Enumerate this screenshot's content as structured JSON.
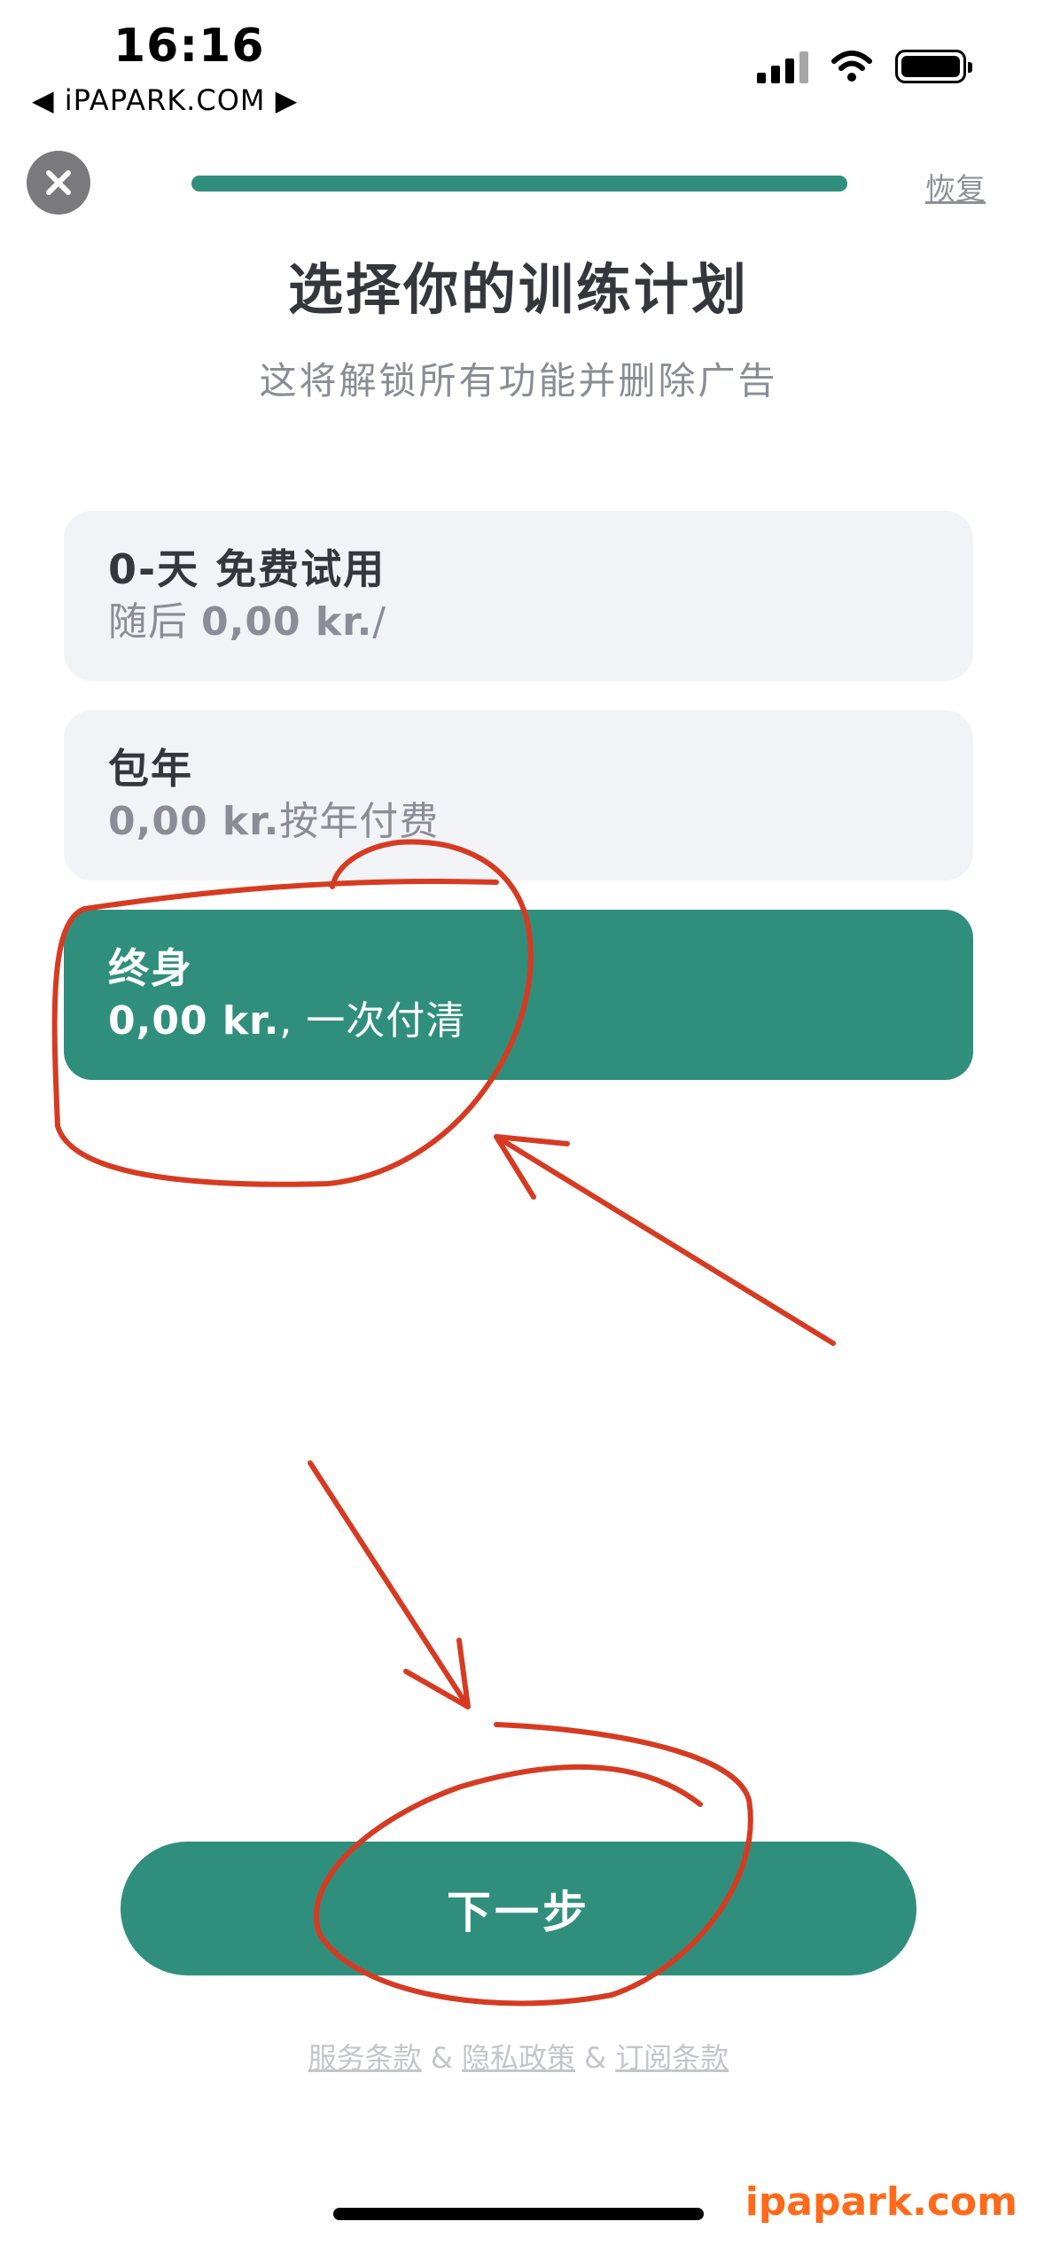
{
  "status_bar": {
    "time": "16:16",
    "back_label": "◀ iPAPARK.COM ▶",
    "icons": [
      "cellular-signal-icon",
      "wifi-icon",
      "battery-icon"
    ]
  },
  "header": {
    "close_icon": "close-icon",
    "progress_fraction": 1.0,
    "restore_label": "恢复"
  },
  "title": "选择你的训练计划",
  "subtitle": "这将解锁所有功能并删除广告",
  "plans": [
    {
      "name": "0-天 免费试用",
      "price_prefix": "随后 ",
      "price": "0,00 kr.",
      "price_suffix": "/",
      "selected": false
    },
    {
      "name": "包年",
      "price_prefix": "",
      "price": "0,00 kr.",
      "price_suffix": "按年付费",
      "selected": false
    },
    {
      "name": "终身",
      "price_prefix": "",
      "price": "0,00 kr.",
      "price_suffix": ", 一次付清",
      "selected": true
    }
  ],
  "next_button_label": "下一步",
  "legal": {
    "terms": "服务条款",
    "sep1": " & ",
    "privacy": "隐私政策",
    "sep2": " & ",
    "subscription": "订阅条款"
  },
  "watermark": "ipapark.com",
  "colors": {
    "accent": "#2f8f7c",
    "card_background": "#f2f3f7",
    "annotation": "#d63b22",
    "watermark": "#ff6a1a"
  }
}
